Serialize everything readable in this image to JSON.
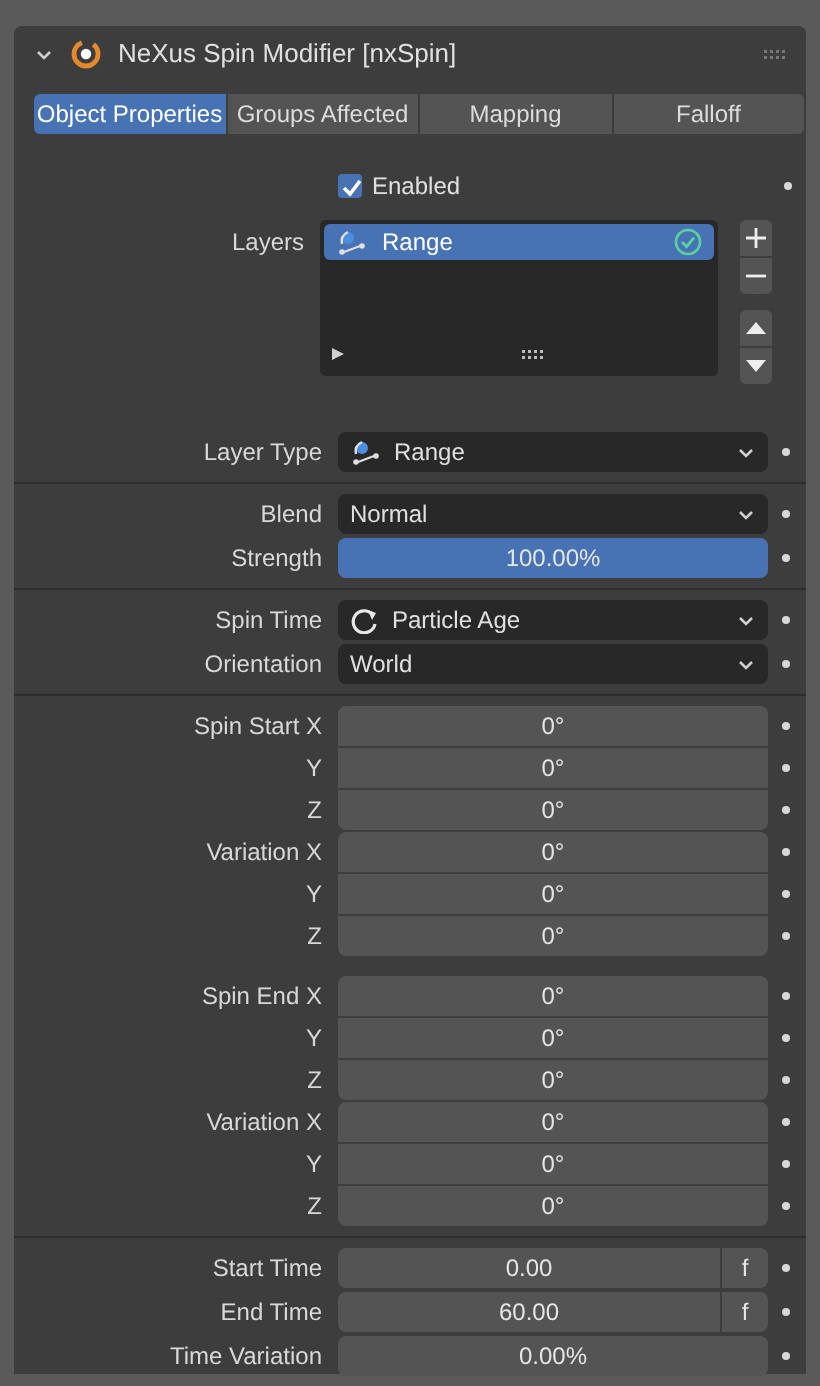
{
  "panel": {
    "title": "NeXus Spin Modifier [nxSpin]",
    "expanded": true
  },
  "tabs": [
    {
      "label": "Object Properties",
      "selected": true
    },
    {
      "label": "Groups Affected",
      "selected": false
    },
    {
      "label": "Mapping",
      "selected": false
    },
    {
      "label": "Falloff",
      "selected": false
    }
  ],
  "enabled": {
    "label": "Enabled",
    "checked": true
  },
  "layers": {
    "label": "Layers",
    "items": [
      {
        "label": "Range",
        "selected": true,
        "active": true
      }
    ]
  },
  "sections": [
    {
      "groups": [
        {
          "rows": [
            {
              "kind": "layerdropdown",
              "label": "Layer Type",
              "value": "Range"
            }
          ]
        }
      ]
    },
    {
      "groups": [
        {
          "rows": [
            {
              "kind": "dropdown",
              "label": "Blend",
              "value": "Normal"
            },
            {
              "kind": "slider",
              "label": "Strength",
              "value": "100.00%",
              "level": 1
            }
          ]
        }
      ]
    },
    {
      "groups": [
        {
          "rows": [
            {
              "kind": "timedropdown",
              "label": "Spin Time",
              "value": "Particle Age"
            },
            {
              "kind": "dropdown",
              "label": "Orientation",
              "value": "World"
            }
          ]
        }
      ]
    },
    {
      "groups": [
        {
          "kind": "vector",
          "spaced": false,
          "rows": [
            {
              "kind": "number",
              "label": "Spin Start X",
              "value": "0°"
            },
            {
              "kind": "number",
              "label": "Y",
              "value": "0°"
            },
            {
              "kind": "number",
              "label": "Z",
              "value": "0°"
            }
          ]
        },
        {
          "kind": "vector",
          "spaced": false,
          "rows": [
            {
              "kind": "number",
              "label": "Variation X",
              "value": "0°"
            },
            {
              "kind": "number",
              "label": "Y",
              "value": "0°"
            },
            {
              "kind": "number",
              "label": "Z",
              "value": "0°"
            }
          ]
        },
        {
          "kind": "vector",
          "spaced": true,
          "rows": [
            {
              "kind": "number",
              "label": "Spin End X",
              "value": "0°"
            },
            {
              "kind": "number",
              "label": "Y",
              "value": "0°"
            },
            {
              "kind": "number",
              "label": "Z",
              "value": "0°"
            }
          ]
        },
        {
          "kind": "vector",
          "spaced": false,
          "rows": [
            {
              "kind": "number",
              "label": "Variation X",
              "value": "0°"
            },
            {
              "kind": "number",
              "label": "Y",
              "value": "0°"
            },
            {
              "kind": "number",
              "label": "Z",
              "value": "0°"
            }
          ]
        }
      ]
    },
    {
      "groups": [
        {
          "rows": [
            {
              "kind": "frame",
              "label": "Start Time",
              "value": "0.00",
              "unit": "f"
            },
            {
              "kind": "frame",
              "label": "End Time",
              "value": "60.00",
              "unit": "f"
            },
            {
              "kind": "slider",
              "label": "Time Variation",
              "value": "0.00%",
              "level": 0
            }
          ]
        }
      ]
    }
  ]
}
